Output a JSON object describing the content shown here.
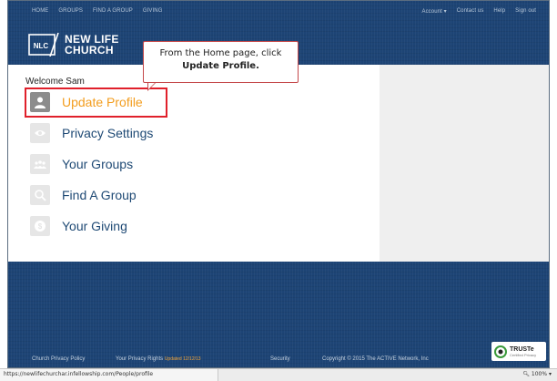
{
  "topnav": {
    "left": [
      "HOME",
      "GROUPS",
      "FIND A GROUP",
      "GIVING"
    ],
    "right": [
      "Account ▾",
      "Contact us",
      "Help",
      "Sign out"
    ]
  },
  "logo": {
    "badge": "NLC",
    "line1": "NEW LIFE",
    "line2": "CHURCH"
  },
  "welcome": "Welcome Sam",
  "menu": [
    {
      "label": "Update Profile",
      "icon": "person-icon",
      "active": true
    },
    {
      "label": "Privacy Settings",
      "icon": "eye-icon",
      "active": false
    },
    {
      "label": "Your Groups",
      "icon": "people-icon",
      "active": false
    },
    {
      "label": "Find A Group",
      "icon": "magnifier-icon",
      "active": false
    },
    {
      "label": "Your Giving",
      "icon": "dollar-icon",
      "active": false
    }
  ],
  "callout": {
    "line1": "From the Home page, click",
    "line2": "Update Profile."
  },
  "footer": {
    "privacy_policy": "Church Privacy Policy",
    "privacy_rights": "Your Privacy Rights",
    "updated": "Updated 12/12/13",
    "security": "Security",
    "copyright": "Copyright © 2015 The ACTIVE Network, Inc",
    "truste": "TRUSTe",
    "truste_sub": "Certified Privacy"
  },
  "statusbar": {
    "url": "https://newlifechurchar.infellowship.com/People/profile",
    "zoom": "100%"
  },
  "colors": {
    "background": "#1d4475",
    "active_label": "#f39d1e",
    "link": "#1f4a75",
    "highlight_border": "#e0202b"
  }
}
